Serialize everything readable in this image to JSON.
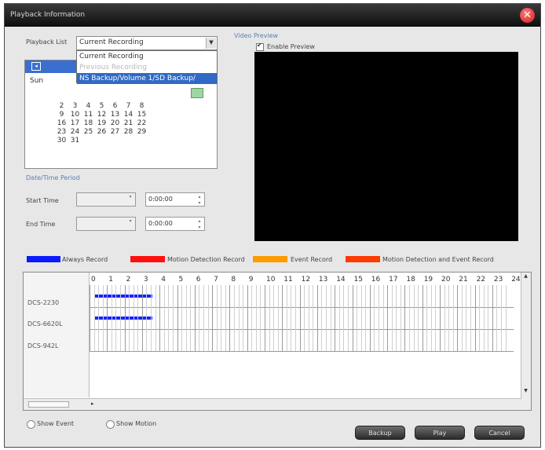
{
  "window": {
    "title": "Playback Information",
    "close_icon": "close-icon"
  },
  "playlist": {
    "label": "Playback List",
    "selected": "Current Recording",
    "options": [
      "Current Recording",
      "Previous Recording",
      "NS Backup/Volume 1/SD Backup/"
    ]
  },
  "calendar": {
    "sun_label": "Sun",
    "days": [
      [
        "2",
        "3",
        "4",
        "5",
        "6",
        "7",
        "8"
      ],
      [
        "9",
        "10",
        "11",
        "12",
        "13",
        "14",
        "15"
      ],
      [
        "16",
        "17",
        "18",
        "19",
        "20",
        "21",
        "22"
      ],
      [
        "23",
        "24",
        "25",
        "26",
        "27",
        "28",
        "29"
      ],
      [
        "30",
        "31"
      ]
    ]
  },
  "date_time_period": {
    "label": "Date/Time Period",
    "start_label": "Start Time",
    "end_label": "End Time",
    "start_time": "0:00:00",
    "end_time": "0:00:00"
  },
  "video_preview": {
    "label": "Video Preview",
    "enable_label": "Enable Preview",
    "enabled": true
  },
  "legend": [
    {
      "label": "Always Record",
      "color": "#0b1bff"
    },
    {
      "label": "Motion Detection Record",
      "color": "#ff1010"
    },
    {
      "label": "Event Record",
      "color": "#ff9a00"
    },
    {
      "label": "Motion Detection and Event Record",
      "color": "#ff3b00"
    }
  ],
  "timeline": {
    "hours": [
      "0",
      "1",
      "2",
      "3",
      "4",
      "5",
      "6",
      "7",
      "8",
      "9",
      "10",
      "11",
      "12",
      "13",
      "14",
      "15",
      "16",
      "17",
      "18",
      "19",
      "20",
      "21",
      "22",
      "23",
      "24"
    ],
    "cameras": [
      "DCS-2230",
      "DCS-6620L",
      "DCS-942L"
    ]
  },
  "options": {
    "show_event": "Show Event",
    "show_motion": "Show Motion"
  },
  "buttons": {
    "backup": "Backup",
    "play": "Play",
    "cancel": "Cancel"
  }
}
